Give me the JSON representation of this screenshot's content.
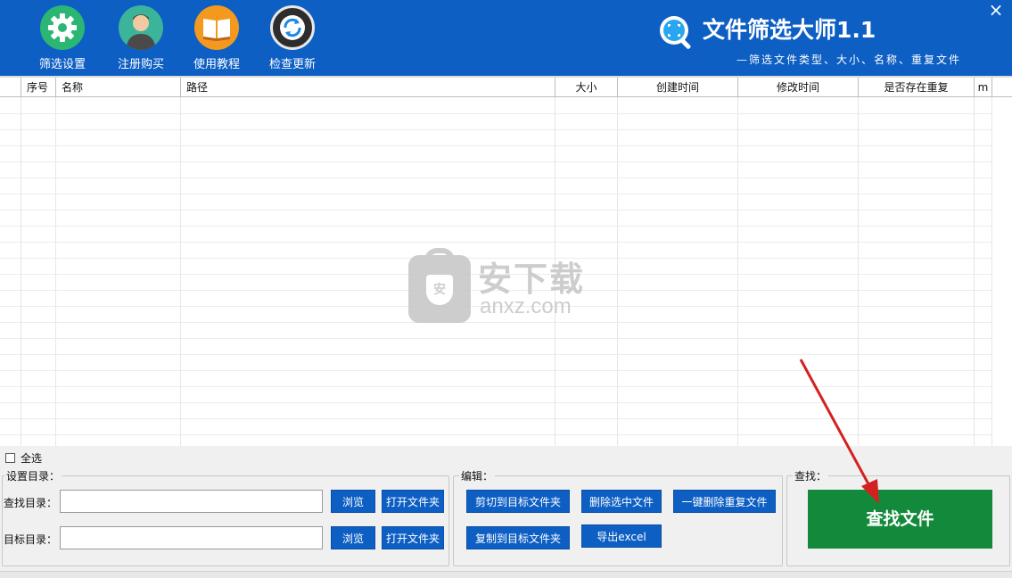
{
  "toolbar": {
    "items": [
      {
        "label": "筛选设置",
        "icon": "gear-icon"
      },
      {
        "label": "注册购买",
        "icon": "user-icon"
      },
      {
        "label": "使用教程",
        "icon": "book-icon"
      },
      {
        "label": "检查更新",
        "icon": "refresh-icon"
      }
    ],
    "close_label": "×"
  },
  "brand": {
    "title": "文件筛选大师1.1",
    "subtitle": "—筛选文件类型、大小、名称、重复文件"
  },
  "table": {
    "columns": [
      "序号",
      "名称",
      "路径",
      "大小",
      "创建时间",
      "修改时间",
      "是否存在重复",
      "m"
    ],
    "rows": []
  },
  "watermark": {
    "cn": "安下载",
    "en": "anxz.com",
    "badge": "安"
  },
  "select_all": {
    "label": "全选",
    "checked": false
  },
  "directory_group": {
    "title": "设置目录：",
    "search_dir_label": "查找目录：",
    "search_dir_value": "",
    "target_dir_label": "目标目录：",
    "target_dir_value": "",
    "browse_label": "浏览",
    "open_folder_label": "打开文件夹"
  },
  "edit_group": {
    "title": "编辑：",
    "cut_label": "剪切到目标文件夹",
    "delete_selected_label": "删除选中文件",
    "delete_duplicates_label": "一键删除重复文件",
    "copy_label": "复制到目标文件夹",
    "export_label": "导出excel"
  },
  "find_group": {
    "title": "查找：",
    "find_label": "查找文件"
  },
  "colors": {
    "header_blue": "#0e5fc4",
    "find_green": "#138a3b",
    "arrow_red": "#d42020"
  }
}
